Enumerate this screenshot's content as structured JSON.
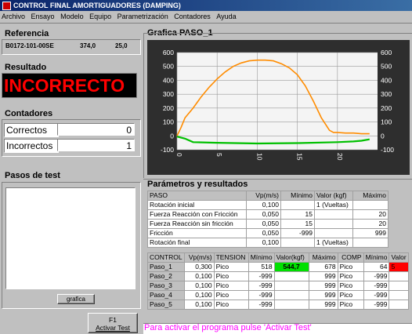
{
  "window": {
    "title": "CONTROL FINAL AMORTIGUADORES (DAMPING)"
  },
  "menu": [
    "Archivo",
    "Ensayo",
    "Modelo",
    "Equipo",
    "Parametrización",
    "Contadores",
    "Ayuda"
  ],
  "referencia": {
    "label": "Referencia",
    "code": "B0172-101-00SE",
    "v1": "374,0",
    "v2": "25,0"
  },
  "resultado": {
    "label": "Resultado",
    "value": "INCORRECTO"
  },
  "contadores": {
    "label": "Contadores",
    "correctos_label": "Correctos",
    "correctos": "0",
    "incorrectos_label": "Incorrectos",
    "incorrectos": "1"
  },
  "pasos": {
    "label": "Pasos de test"
  },
  "grafica_button": "grafica",
  "f1": {
    "key": "F1",
    "label": "Activar Test"
  },
  "graph": {
    "title": "Grafica PASO_1",
    "yticks": [
      "600",
      "500",
      "400",
      "300",
      "200",
      "100",
      "0",
      "-100"
    ],
    "xticks": [
      "0",
      "5",
      "10",
      "15",
      "20"
    ]
  },
  "chart_data": {
    "type": "line",
    "ylim": [
      -100,
      600
    ],
    "xlim": [
      0,
      25
    ],
    "x_ticks": [
      0,
      5,
      10,
      15,
      20
    ],
    "series": [
      {
        "color": "#ff8c00",
        "x": [
          0,
          0.5,
          1,
          2,
          3,
          4,
          5,
          6,
          7,
          8,
          9,
          10,
          11,
          12,
          13,
          14,
          15,
          16,
          17,
          18,
          19,
          19.5,
          20,
          21,
          22,
          23,
          24
        ],
        "values": [
          0,
          60,
          130,
          200,
          280,
          350,
          410,
          460,
          500,
          525,
          540,
          545,
          545,
          540,
          520,
          490,
          440,
          360,
          250,
          130,
          40,
          25,
          25,
          20,
          20,
          15,
          15
        ]
      },
      {
        "color": "#00c000",
        "x": [
          0,
          1,
          2,
          5,
          10,
          15,
          20,
          22,
          23,
          24
        ],
        "values": [
          -5,
          -20,
          -45,
          -50,
          -55,
          -52,
          -45,
          -40,
          -35,
          -25
        ]
      }
    ]
  },
  "params": {
    "title": "Parámetros y resultados",
    "headers": [
      "PASO",
      "Vp(m/s)",
      "Mínimo",
      "Valor (kgf)",
      "Máximo"
    ],
    "rows": [
      [
        "Rotación inicial",
        "0,100",
        "",
        "1 (Vueltas)",
        ""
      ],
      [
        "Fuerza Reacción con Fricción",
        "0,050",
        "15",
        "",
        "20"
      ],
      [
        "Fuerza Reacción sin fricción",
        "0,050",
        "15",
        "",
        "20"
      ],
      [
        "Fricción",
        "0,050",
        "-999",
        "",
        "999"
      ],
      [
        "Rotación final",
        "0,100",
        "",
        "1 (Vueltas)",
        ""
      ]
    ]
  },
  "control": {
    "headers": [
      "CONTROL",
      "Vp(m/s)",
      "TENSION",
      "Mínimo",
      "Valor(kgf)",
      "Máximo",
      "COMP",
      "Mínimo",
      "Valor"
    ],
    "rows": [
      [
        "Paso_1",
        "0,300",
        "Pico",
        "518",
        "544,7",
        "678",
        "Pico",
        "64",
        "5"
      ],
      [
        "Paso_2",
        "0,100",
        "Pico",
        "-999",
        "",
        "999",
        "Pico",
        "-999",
        ""
      ],
      [
        "Paso_3",
        "0,100",
        "Pico",
        "-999",
        "",
        "999",
        "Pico",
        "-999",
        ""
      ],
      [
        "Paso_4",
        "0,100",
        "Pico",
        "-999",
        "",
        "999",
        "Pico",
        "-999",
        ""
      ],
      [
        "Paso_5",
        "0,100",
        "Pico",
        "-999",
        "",
        "999",
        "Pico",
        "-999",
        ""
      ]
    ]
  },
  "status": "Para activar el programa pulse 'Activar Test'",
  "colors": {
    "ok": "#00e000",
    "bad": "#ff0000",
    "series1": "#ff8c00",
    "series2": "#00c000"
  }
}
